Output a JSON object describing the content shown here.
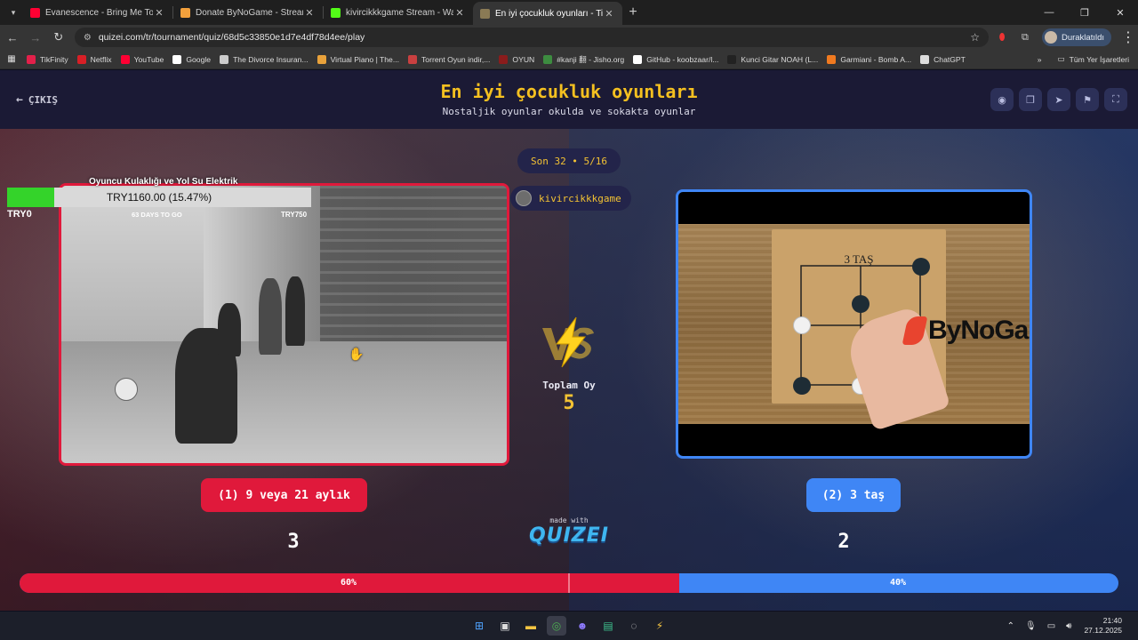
{
  "browser": {
    "tabs": [
      {
        "title": "Evanescence - Bring Me To Life",
        "favicon_color": "#ff0033",
        "active": false
      },
      {
        "title": "Donate ByNoGame - Streamer",
        "favicon_color": "#f2a03c",
        "active": false
      },
      {
        "title": "kivircikkkgame Stream - Watch",
        "favicon_color": "#53fc18",
        "active": false
      },
      {
        "title": "En iyi çocukluk oyunları - Tier L",
        "favicon_color": "#8a7a55",
        "active": true
      }
    ],
    "url": "quizei.com/tr/tournament/quiz/68d5c33850e1d7e4df78d4ee/play",
    "profile_label": "Duraklatıldı",
    "bookmarks": [
      {
        "label": "TikFinity",
        "color": "#e3204a"
      },
      {
        "label": "Netflix",
        "color": "#d81f26"
      },
      {
        "label": "YouTube",
        "color": "#ff0033"
      },
      {
        "label": "Google",
        "color": "#ffffff"
      },
      {
        "label": "The Divorce Insuran...",
        "color": "#cccccc"
      },
      {
        "label": "Virtual Piano | The...",
        "color": "#e9a23b"
      },
      {
        "label": "Torrent Oyun indir,...",
        "color": "#c94040"
      },
      {
        "label": "OYUN",
        "color": "#8a1c1c"
      },
      {
        "label": "#kanji 翻 - Jisho.org",
        "color": "#3d8c40"
      },
      {
        "label": "GitHub - koobzaar/l...",
        "color": "#ffffff"
      },
      {
        "label": "Kunci Gitar NOAH (L...",
        "color": "#222222"
      },
      {
        "label": "Garmiani - Bomb A...",
        "color": "#f07a20"
      },
      {
        "label": "ChatGPT",
        "color": "#dddddd"
      }
    ],
    "all_bookmarks_label": "Tüm Yer İşaretleri"
  },
  "page": {
    "exit_label": "ÇIKIŞ",
    "title": "En iyi çocukluk oyunları",
    "subtitle": "Nostaljik oyunlar okulda ve sokakta oyunlar",
    "round_label": "Son 32 • 5/16",
    "streamer_name": "kivircikkkgame",
    "total_label": "Toplam Oy",
    "total_value": "5",
    "made_with_label": "made with",
    "made_with_logo": "QUIZEI",
    "accent_left": "#e0193b",
    "accent_right": "#3f86f5",
    "accent_gold": "#f3c233"
  },
  "donation_widget": {
    "title": "Oyuncu Kulaklığı ve Yol Su Elektrik",
    "progress_text": "TRY1160.00 (15.47%)",
    "progress_fraction": 0.1547,
    "min_label": "TRY0",
    "days_label": "63 DAYS TO GO",
    "max_label": "TRY750"
  },
  "left_option": {
    "label": "(1) 9 veya 21 aylık",
    "votes": "3",
    "percent_label": "60%",
    "percent": 60
  },
  "right_option": {
    "label": "(2) 3 taş",
    "votes": "2",
    "percent_label": "40%",
    "percent": 40,
    "video_board_label": "3 TAŞ",
    "video_logo": "ByNoGame"
  },
  "taskbar": {
    "time": "21:40",
    "date": "27.12.2025"
  }
}
